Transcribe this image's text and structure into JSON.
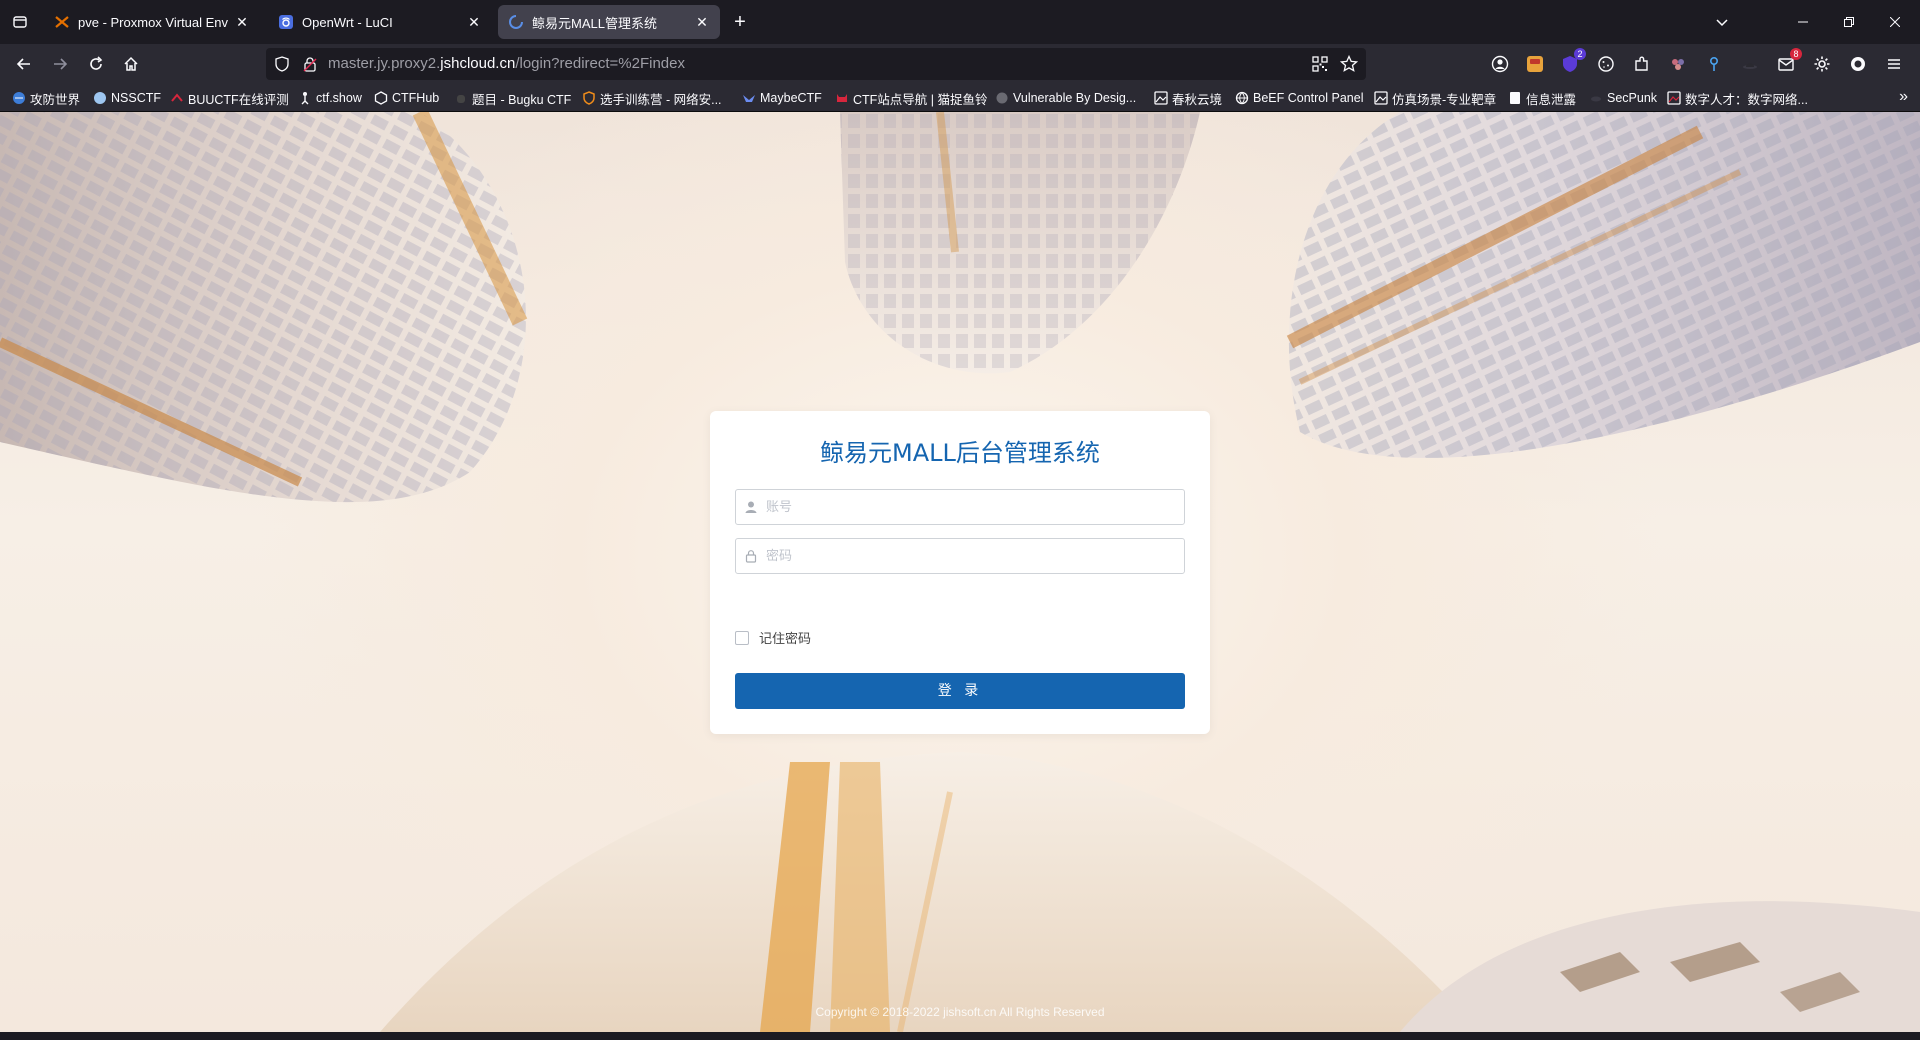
{
  "browser": {
    "tabs": [
      {
        "title": "pve - Proxmox Virtual Environment",
        "favicon": "proxmox-icon",
        "active": false
      },
      {
        "title": "OpenWrt - LuCI",
        "favicon": "openwrt-icon",
        "active": false
      },
      {
        "title": "鲸易元MALL管理系统",
        "favicon": "loading-icon",
        "active": true
      }
    ],
    "url": {
      "prefix": "master.jy.proxy2.",
      "domain": "jshcloud.cn",
      "path": "/login?redirect=%2Findex"
    },
    "extension_badges": {
      "ext_purple": "2",
      "ext_mail": "8"
    },
    "bookmarks": [
      {
        "label": "攻防世界",
        "icon": "globe-icon"
      },
      {
        "label": "NSSCTF",
        "icon": "nss-icon"
      },
      {
        "label": "BUUCTF在线评测",
        "icon": "buu-icon"
      },
      {
        "label": "ctf.show",
        "icon": "ctfshow-icon"
      },
      {
        "label": "CTFHub",
        "icon": "hub-icon"
      },
      {
        "label": "题目 - Bugku CTF",
        "icon": "bug-icon"
      },
      {
        "label": "选手训练营 - 网络安...",
        "icon": "shield-icon"
      },
      {
        "label": "MaybeCTF",
        "icon": "bird-icon"
      },
      {
        "label": "CTF站点导航 | 猫捉鱼铃",
        "icon": "cat-icon"
      },
      {
        "label": "Vulnerable By Desig...",
        "icon": "vuln-icon"
      },
      {
        "label": "春秋云境",
        "icon": "image-icon"
      },
      {
        "label": "BeEF Control Panel",
        "icon": "globe-icon"
      },
      {
        "label": "仿真场景-专业靶章",
        "icon": "image-icon"
      },
      {
        "label": "信息泄露",
        "icon": "doc-icon"
      },
      {
        "label": "SecPunk",
        "icon": "punk-icon"
      },
      {
        "label": "数字人才：数字网络...",
        "icon": "image-icon"
      }
    ]
  },
  "login": {
    "title": "鲸易元MALL后台管理系统",
    "username_placeholder": "账号",
    "password_placeholder": "密码",
    "remember_label": "记住密码",
    "submit_label": "登 录"
  },
  "footer": {
    "copyright": "Copyright © 2018-2022 jishsoft.cn All Rights Reserved"
  },
  "colors": {
    "accent": "#1565b0",
    "browser_bg": "#1c1b22",
    "toolbar_bg": "#2b2a33"
  }
}
